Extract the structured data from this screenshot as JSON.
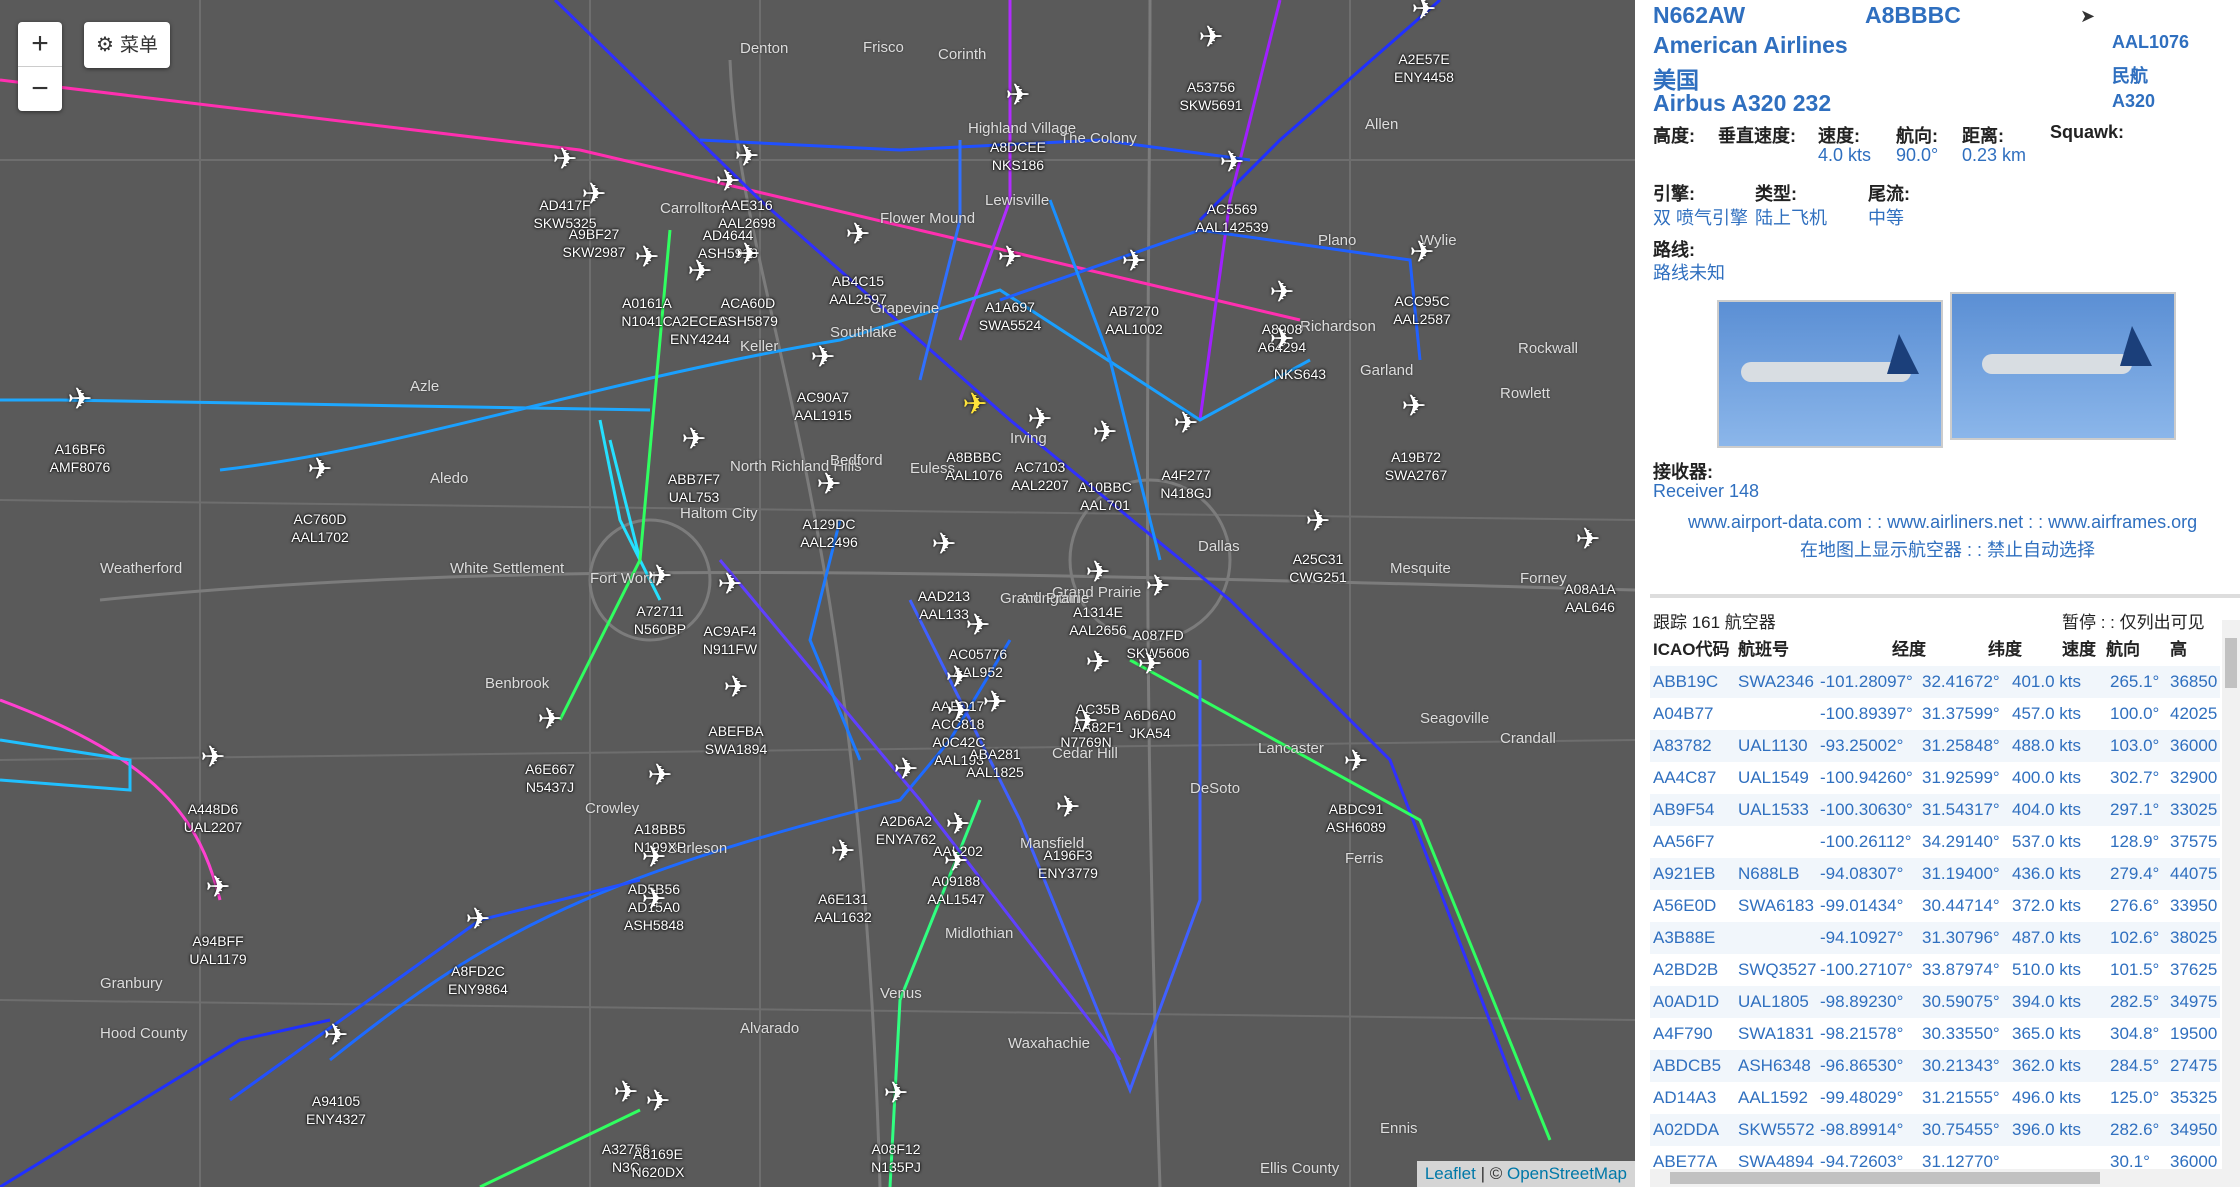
{
  "map": {
    "zoom_in": "+",
    "zoom_out": "−",
    "menu_label": "菜单",
    "attribution_leaflet": "Leaflet",
    "attribution_sep": " | © ",
    "attribution_osm": "OpenStreetMap",
    "place_labels": [
      "Frisco",
      "Allen",
      "Lewisville",
      "Plano",
      "Wylie",
      "Garland",
      "Denton",
      "Carrollton",
      "Richardson",
      "Grapevine",
      "North Richland Hills",
      "Bedford",
      "Euless",
      "Irving",
      "Dallas",
      "Fort Worth",
      "Arlington",
      "Grand Prairie",
      "Mesquite",
      "Cedar Hill",
      "DeSoto",
      "Lancaster",
      "Mansfield",
      "Burleson",
      "Crowley",
      "Benbrook",
      "Weatherford",
      "Granbury",
      "Alvarado",
      "Waxahachie",
      "Midlothian",
      "Ennis",
      "Seagoville",
      "Crandall",
      "Forney",
      "Rockwall",
      "Aledo",
      "Azle",
      "Haltom City",
      "Hood County",
      "Ellis County",
      "White Settlement",
      "The Colony",
      "Highland Village",
      "Southlake",
      "Keller",
      "Flower Mound",
      "Corinth",
      "Venus",
      "Ferris",
      "Rowlett",
      "Grand Prairie"
    ],
    "aircraft": [
      {
        "line1": "A53756",
        "line2": "SKW5691"
      },
      {
        "line1": "A2E57E",
        "line2": "ENY4458"
      },
      {
        "line1": "A8DCEE",
        "line2": "NKS186"
      },
      {
        "line1": "AD417F",
        "line2": "SKW5325"
      },
      {
        "line1": "A9BF27",
        "line2": "SKW2987"
      },
      {
        "line1": "AAE316",
        "line2": "AAL2698"
      },
      {
        "line1": "AD4644",
        "line2": "ASH5918"
      },
      {
        "line1": "AB4C15",
        "line2": "AAL2597"
      },
      {
        "line1": "AC5569",
        "line2": "AAL142539"
      },
      {
        "line1": "ACC95C",
        "line2": "AAL2587"
      },
      {
        "line1": "A0161A",
        "line2": "N1041C"
      },
      {
        "line1": "A2ECEC",
        "line2": "ENY4244"
      },
      {
        "line1": "ACA60D",
        "line2": "ASH5879"
      },
      {
        "line1": "A1A697",
        "line2": "SWA5524"
      },
      {
        "line1": "AB7270",
        "line2": "AAL1002"
      },
      {
        "line1": "A8908",
        "line2": "A64294"
      },
      {
        "line1": "",
        "line2": "NKS643"
      },
      {
        "line1": "A16BF6",
        "line2": "AMF8076"
      },
      {
        "line1": "AC90A7",
        "line2": "AAL1915"
      },
      {
        "line1": "A8BBBC",
        "line2": "AAL1076"
      },
      {
        "line1": "AC7103",
        "line2": "AAL2207"
      },
      {
        "line1": "A10BBC",
        "line2": "AAL701"
      },
      {
        "line1": "A4F277",
        "line2": "N418GJ"
      },
      {
        "line1": "A19B72",
        "line2": "SWA2767"
      },
      {
        "line1": "ABB7F7",
        "line2": "UAL753"
      },
      {
        "line1": "AC760D",
        "line2": "AAL1702"
      },
      {
        "line1": "A129DC",
        "line2": "AAL2496"
      },
      {
        "line1": "A25C31",
        "line2": "CWG251"
      },
      {
        "line1": "A08A1A",
        "line2": "AAL646"
      },
      {
        "line1": "A72711",
        "line2": "N560BP"
      },
      {
        "line1": "AC9AF4",
        "line2": "N911FW"
      },
      {
        "line1": "AAD213",
        "line2": "AAL133"
      },
      {
        "line1": "A1314E",
        "line2": "AAL2656"
      },
      {
        "line1": "A087FD",
        "line2": "SKW5606"
      },
      {
        "line1": "AC05776",
        "line2": "AAL952"
      },
      {
        "line1": "ABEFBA",
        "line2": "SWA1894"
      },
      {
        "line1": "AAFD17",
        "line2": "ACC818"
      },
      {
        "line1": "A0C42C",
        "line2": "AAL193"
      },
      {
        "line1": "ABA281",
        "line2": "AAL1825"
      },
      {
        "line1": "AC35B",
        "line2": "AA82F1"
      },
      {
        "line1": "A6D6A0",
        "line2": "JKA54"
      },
      {
        "line1": "",
        "line2": "N7769N"
      },
      {
        "line1": "A6E667",
        "line2": "N5437J"
      },
      {
        "line1": "A448D6",
        "line2": "UAL2207"
      },
      {
        "line1": "A18BB5",
        "line2": "N199XP"
      },
      {
        "line1": "AD5B56",
        "line2": "AD15A0"
      },
      {
        "line1": "",
        "line2": "ASH5848"
      },
      {
        "line1": "A2D6A2",
        "line2": "ENYA762"
      },
      {
        "line1": "",
        "line2": "AAL202"
      },
      {
        "line1": "ABDC91",
        "line2": "ASH6089"
      },
      {
        "line1": "A6E131",
        "line2": "AAL1632"
      },
      {
        "line1": "A09188",
        "line2": "AAL1547"
      },
      {
        "line1": "A196F3",
        "line2": "ENY3779"
      },
      {
        "line1": "A94BFF",
        "line2": "UAL1179"
      },
      {
        "line1": "A8FD2C",
        "line2": "ENY9864"
      },
      {
        "line1": "A94105",
        "line2": "ENY4327"
      },
      {
        "line1": "A32756",
        "line2": "N3C"
      },
      {
        "line1": "A8169E",
        "line2": "N620DX"
      },
      {
        "line1": "A08F12",
        "line2": "N135PJ"
      }
    ]
  },
  "info": {
    "registration": "N662AW",
    "icao": "A8BBBC",
    "airline": "American Airlines",
    "flight": "AAL1076",
    "country": "美国",
    "category": "民航",
    "model": "Airbus A320 232",
    "type_code": "A320",
    "altitude_label": "高度:",
    "vspeed_label": "垂直速度:",
    "speed_label": "速度:",
    "speed_value": "4.0 kts",
    "heading_label": "航向:",
    "heading_value": "90.0°",
    "distance_label": "距离:",
    "distance_value": "0.23 km",
    "squawk_label": "Squawk:",
    "engine_label": "引擎:",
    "engine_value": "双 喷气引擎",
    "type_label": "类型:",
    "type_value": "陆上飞机",
    "wake_label": "尾流:",
    "wake_value": "中等",
    "route_label": "路线:",
    "route_value": "路线未知",
    "receiver_label": "接收器:",
    "receiver_value": "Receiver 148",
    "link_airport_data": "www.airport-data.com",
    "link_sep": " : : ",
    "link_airliners": "www.airliners.net",
    "link_airframes": "www.airframes.org",
    "link_show_on_map": "在地图上显示航空器",
    "link_disable_autoselect": "禁止自动选择"
  },
  "table": {
    "tracked": "跟踪 161 航空器",
    "pause": "暂停 : : 仅列出可见",
    "headers": [
      "ICAO代码",
      "航班号",
      "经度",
      "纬度",
      "速度",
      "航向",
      "高"
    ],
    "rows": [
      [
        "ABB19C",
        "SWA2346",
        "-101.28097°",
        "32.41672°",
        "401.0 kts",
        "265.1°",
        "36850"
      ],
      [
        "A04B77",
        "",
        "-100.89397°",
        "31.37599°",
        "457.0 kts",
        "100.0°",
        "42025"
      ],
      [
        "A83782",
        "UAL1130",
        "-93.25002°",
        "31.25848°",
        "488.0 kts",
        "103.0°",
        "36000"
      ],
      [
        "AA4C87",
        "UAL1549",
        "-100.94260°",
        "31.92599°",
        "400.0 kts",
        "302.7°",
        "32900"
      ],
      [
        "AB9F54",
        "UAL1533",
        "-100.30630°",
        "31.54317°",
        "404.0 kts",
        "297.1°",
        "33025"
      ],
      [
        "AA56F7",
        "",
        "-100.26112°",
        "34.29140°",
        "537.0 kts",
        "128.9°",
        "37575"
      ],
      [
        "A921EB",
        "N688LB",
        "-94.08307°",
        "31.19400°",
        "436.0 kts",
        "279.4°",
        "44075"
      ],
      [
        "A56E0D",
        "SWA6183",
        "-99.01434°",
        "30.44714°",
        "372.0 kts",
        "276.6°",
        "33950"
      ],
      [
        "A3B88E",
        "",
        "-94.10927°",
        "31.30796°",
        "487.0 kts",
        "102.6°",
        "38025"
      ],
      [
        "A2BD2B",
        "SWQ3527",
        "-100.27107°",
        "33.87974°",
        "510.0 kts",
        "101.5°",
        "37625"
      ],
      [
        "A0AD1D",
        "UAL1805",
        "-98.89230°",
        "30.59075°",
        "394.0 kts",
        "282.5°",
        "34975"
      ],
      [
        "A4F790",
        "SWA1831",
        "-98.21578°",
        "30.33550°",
        "365.0 kts",
        "304.8°",
        "19500"
      ],
      [
        "ABDCB5",
        "ASH6348",
        "-96.86530°",
        "30.21343°",
        "362.0 kts",
        "284.5°",
        "27475"
      ],
      [
        "AD14A3",
        "AAL1592",
        "-99.48029°",
        "31.21555°",
        "496.0 kts",
        "125.0°",
        "35325"
      ],
      [
        "A02DDA",
        "SKW5572",
        "-98.89914°",
        "30.75455°",
        "396.0 kts",
        "282.6°",
        "34950"
      ],
      [
        "ABE77A",
        "SWA4894",
        "-94.72603°",
        "31.12770°",
        "",
        "30.1°",
        "36000"
      ]
    ]
  }
}
